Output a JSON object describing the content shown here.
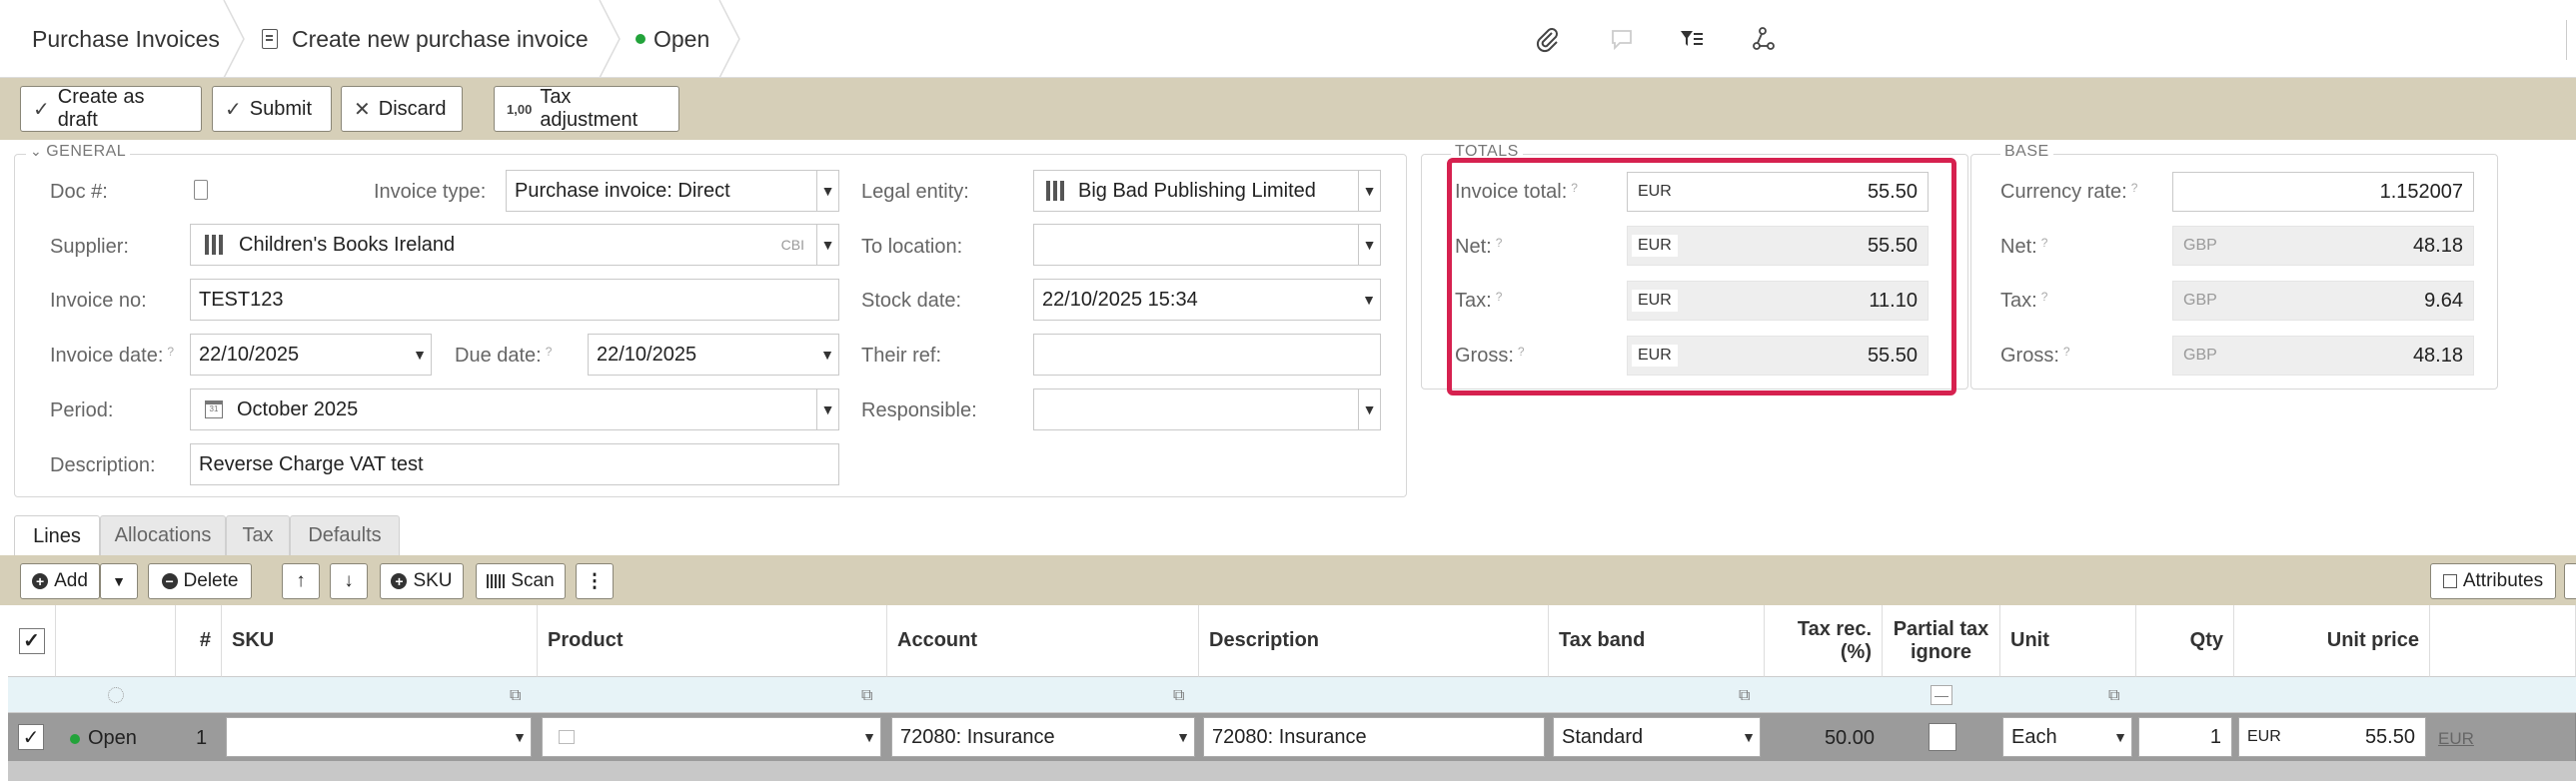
{
  "breadcrumb": {
    "item1": "Purchase Invoices",
    "item2": "Create new purchase invoice",
    "item3": "Open"
  },
  "toolbar": {
    "create_draft": "Create as draft",
    "submit": "Submit",
    "discard": "Discard",
    "tax_adjustment": "Tax adjustment"
  },
  "general": {
    "legend": "GENERAL",
    "doc_label": "Doc #:",
    "invoice_type_label": "Invoice type:",
    "invoice_type_value": "Purchase invoice: Direct",
    "legal_entity_label": "Legal entity:",
    "legal_entity_value": "Big Bad Publishing Limited",
    "supplier_label": "Supplier:",
    "supplier_value": "Children's Books Ireland",
    "supplier_code": "CBI",
    "to_location_label": "To location:",
    "to_location_value": "",
    "invoice_no_label": "Invoice no:",
    "invoice_no_value": "TEST123",
    "stock_date_label": "Stock date:",
    "stock_date_value": "22/10/2025 15:34",
    "invoice_date_label": "Invoice date:",
    "invoice_date_value": "22/10/2025",
    "due_date_label": "Due date:",
    "due_date_value": "22/10/2025",
    "their_ref_label": "Their ref:",
    "their_ref_value": "",
    "period_label": "Period:",
    "period_value": "October 2025",
    "responsible_label": "Responsible:",
    "responsible_value": "",
    "description_label": "Description:",
    "description_value": "Reverse Charge VAT test"
  },
  "totals": {
    "legend": "TOTALS",
    "invoice_total_label": "Invoice total:",
    "invoice_total_cur": "EUR",
    "invoice_total_value": "55.50",
    "net_label": "Net:",
    "net_cur": "EUR",
    "net_value": "55.50",
    "tax_label": "Tax:",
    "tax_cur": "EUR",
    "tax_value": "11.10",
    "gross_label": "Gross:",
    "gross_cur": "EUR",
    "gross_value": "55.50"
  },
  "base": {
    "legend": "BASE",
    "currency_rate_label": "Currency rate:",
    "currency_rate_value": "1.152007",
    "net_label": "Net:",
    "net_cur": "GBP",
    "net_value": "48.18",
    "tax_label": "Tax:",
    "tax_cur": "GBP",
    "tax_value": "9.64",
    "gross_label": "Gross:",
    "gross_cur": "GBP",
    "gross_value": "48.18"
  },
  "tabs": [
    "Lines",
    "Allocations",
    "Tax",
    "Defaults"
  ],
  "line_toolbar": {
    "add": "Add",
    "delete": "Delete",
    "sku": "SKU",
    "scan": "Scan",
    "attributes": "Attributes"
  },
  "grid": {
    "headers": {
      "num": "#",
      "sku": "SKU",
      "product": "Product",
      "account": "Account",
      "description": "Description",
      "tax_band": "Tax band",
      "tax_rec": "Tax rec. (%)",
      "partial_tax": "Partial tax ignore",
      "unit": "Unit",
      "qty": "Qty",
      "unit_price": "Unit price"
    },
    "row1": {
      "status": "Open",
      "num": "1",
      "sku": "",
      "product": "",
      "account": "72080: Insurance",
      "description": "72080: Insurance",
      "tax_band": "Standard",
      "tax_rec": "50.00",
      "unit": "Each",
      "qty": "1",
      "unit_price_cur": "EUR",
      "unit_price": "55.50",
      "trailing_cur": "EUR"
    }
  }
}
